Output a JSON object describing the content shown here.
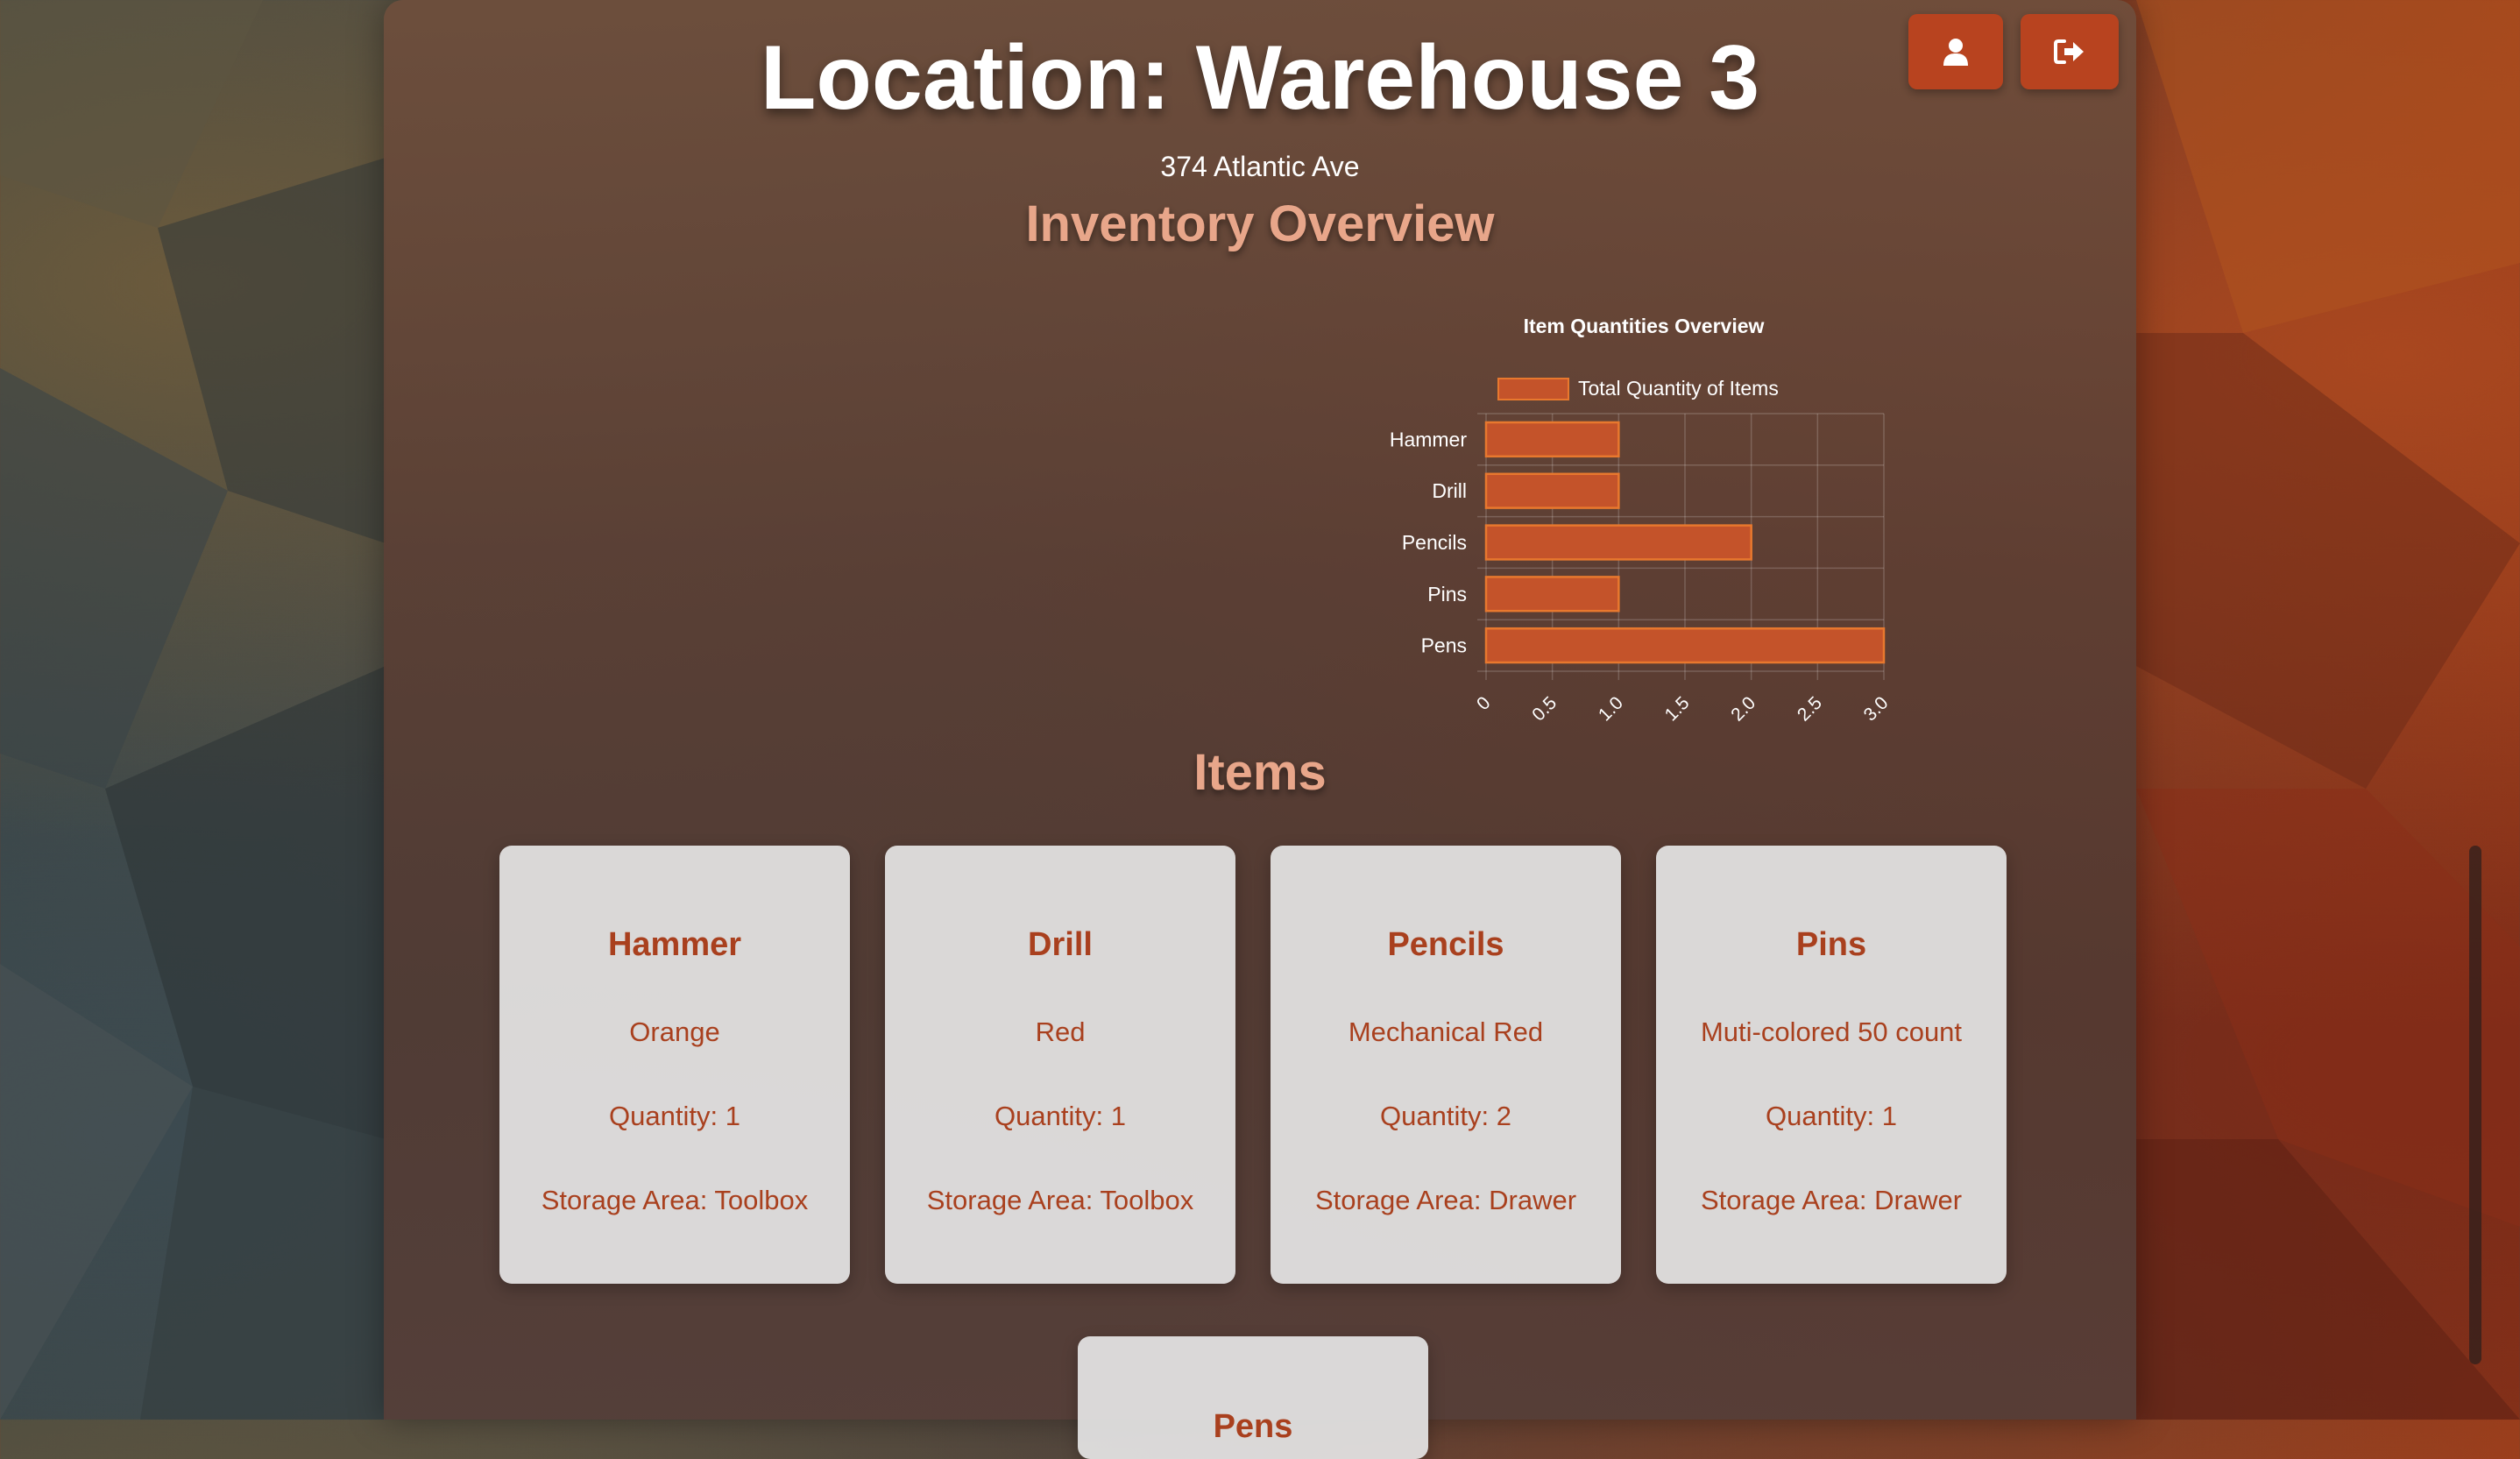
{
  "header": {
    "title": "Location: Warehouse 3",
    "address": "374 Atlantic Ave",
    "profile_icon": "user-icon",
    "logout_icon": "sign-out-icon"
  },
  "overview": {
    "title": "Inventory Overview"
  },
  "items_section": {
    "title": "Items"
  },
  "chart_data": {
    "type": "bar",
    "orientation": "horizontal",
    "title": "Item Quantities Overview",
    "categories": [
      "Hammer",
      "Drill",
      "Pencils",
      "Pins",
      "Pens"
    ],
    "series": [
      {
        "name": "Total Quantity of Items",
        "values": [
          1,
          1,
          2,
          1,
          3
        ]
      }
    ],
    "xticks": [
      "0",
      "0.5",
      "1.0",
      "1.5",
      "2.0",
      "2.5",
      "3.0"
    ],
    "xlim": [
      0,
      3
    ],
    "grid": true,
    "legend": "top",
    "bar_color": "#c4532a",
    "bar_border": "#e8782e"
  },
  "items": [
    {
      "name": "Hammer",
      "description": "Orange",
      "quantity": "Quantity: 1",
      "storage": "Storage Area: Toolbox"
    },
    {
      "name": "Drill",
      "description": "Red",
      "quantity": "Quantity: 1",
      "storage": "Storage Area: Toolbox"
    },
    {
      "name": "Pencils",
      "description": "Mechanical Red",
      "quantity": "Quantity: 2",
      "storage": "Storage Area: Drawer"
    },
    {
      "name": "Pins",
      "description": "Muti-colored 50 count",
      "quantity": "Quantity: 1",
      "storage": "Storage Area: Drawer"
    }
  ],
  "partial_item": {
    "name": "Pens"
  },
  "colors": {
    "accent": "#b8431f",
    "card_text": "#a9401e",
    "section_title": "#e8a68a"
  }
}
